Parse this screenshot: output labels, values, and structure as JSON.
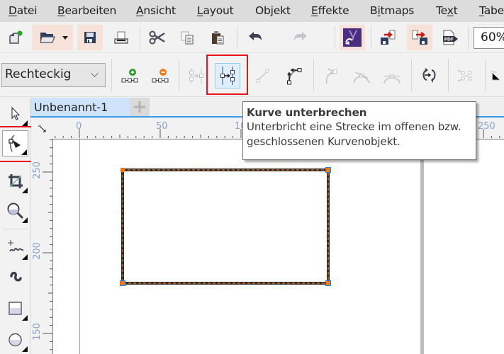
{
  "menubar": {
    "items": [
      {
        "label": "Datei",
        "mnemonic": "D"
      },
      {
        "label": "Bearbeiten",
        "mnemonic": "B"
      },
      {
        "label": "Ansicht",
        "mnemonic": "A"
      },
      {
        "label": "Layout",
        "mnemonic": "L"
      },
      {
        "label": "Objekt",
        "mnemonic": "j"
      },
      {
        "label": "Effekte",
        "mnemonic": "E"
      },
      {
        "label": "Bitmaps",
        "mnemonic": "i"
      },
      {
        "label": "Text",
        "mnemonic": "x"
      },
      {
        "label": "Tabe",
        "mnemonic": "T"
      }
    ]
  },
  "standard_toolbar": {
    "buttons": [
      "new-document",
      "open",
      "save",
      "print",
      "cut",
      "copy",
      "paste",
      "undo",
      "redo",
      "corel-connect",
      "import",
      "export",
      "publish-pdf"
    ],
    "zoom_level": "60%"
  },
  "property_bar": {
    "node_type_select": "Rechteckig",
    "buttons": [
      "add-node",
      "delete-node",
      "join-nodes",
      "break-curve",
      "to-line",
      "to-curve",
      "cusp-node",
      "smooth-node",
      "symmetrical-node",
      "reverse-direction",
      "extend-curve-to-close"
    ],
    "active_button": "break-curve"
  },
  "toolbox": {
    "tools": [
      "pick",
      "shape",
      "crop",
      "zoom",
      "freehand",
      "artistic-media",
      "rectangle",
      "ellipse"
    ],
    "active_tool": "shape"
  },
  "document": {
    "tab_label": "Unbenannt-1",
    "add_tab_symbol": "+"
  },
  "rulers": {
    "horizontal_labels": [
      "0",
      "50",
      "10",
      "250"
    ],
    "vertical_labels": [
      "250",
      "200",
      "150"
    ]
  },
  "tooltip": {
    "title": "Kurve unterbrechen",
    "line1": "Unterbricht eine Strecke im offenen bzw.",
    "line2": "geschlossenen Kurvenobjekt."
  },
  "colors": {
    "highlight_frame": "#e8141c",
    "active_button_bg": "#e0efff",
    "tab_bg": "#cfe4fa",
    "tab_underline": "#3c9be6",
    "node_orange": "#f07a1e",
    "node_blue": "#2a7fe0"
  }
}
